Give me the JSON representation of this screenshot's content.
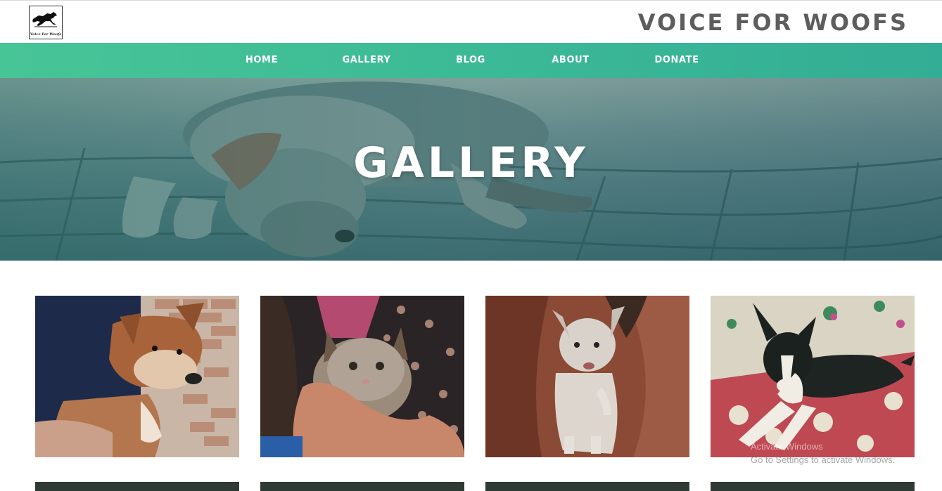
{
  "header": {
    "brand": "VOICE FOR WOOFS",
    "logo_text": "Voice For Woofs",
    "logo_icon": "running-dog-icon"
  },
  "nav": {
    "items": [
      {
        "label": "HOME"
      },
      {
        "label": "GALLERY"
      },
      {
        "label": "BLOG"
      },
      {
        "label": "ABOUT"
      },
      {
        "label": "DONATE"
      }
    ]
  },
  "hero": {
    "title": "GALLERY",
    "image": "sleeping-dog-on-pavement"
  },
  "gallery": {
    "photos": [
      {
        "subject": "brown-puppy-held"
      },
      {
        "subject": "tabby-kitten-in-hands"
      },
      {
        "subject": "white-puppy-on-lap"
      },
      {
        "subject": "black-white-puppy-on-blanket"
      }
    ]
  },
  "system": {
    "activation_line1": "Activate Windows",
    "activation_line2": "Go to Settings to activate Windows."
  },
  "colors": {
    "nav_gradient_start": "#48c597",
    "nav_gradient_end": "#33ad95",
    "brand_text": "#5d5d5d"
  }
}
